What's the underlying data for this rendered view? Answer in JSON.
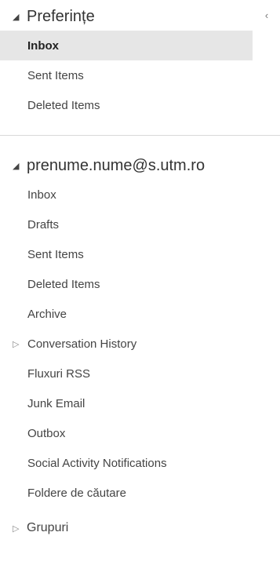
{
  "favorites": {
    "header": "Preferințe",
    "items": [
      {
        "label": "Inbox",
        "selected": true
      },
      {
        "label": "Sent Items"
      },
      {
        "label": "Deleted Items"
      }
    ]
  },
  "account": {
    "header": "prenume.nume@s.utm.ro",
    "items": [
      {
        "label": "Inbox"
      },
      {
        "label": "Drafts"
      },
      {
        "label": "Sent Items"
      },
      {
        "label": "Deleted Items"
      },
      {
        "label": "Archive"
      },
      {
        "label": "Conversation History",
        "expandable": true
      },
      {
        "label": "Fluxuri RSS"
      },
      {
        "label": "Junk Email"
      },
      {
        "label": "Outbox"
      },
      {
        "label": "Social Activity Notifications"
      },
      {
        "label": "Foldere de căutare"
      }
    ]
  },
  "groups": {
    "header": "Grupuri"
  },
  "icons": {
    "expanded": "triangle-down-icon",
    "collapsed": "triangle-right-icon",
    "collapse_pane": "chevron-left-icon"
  }
}
